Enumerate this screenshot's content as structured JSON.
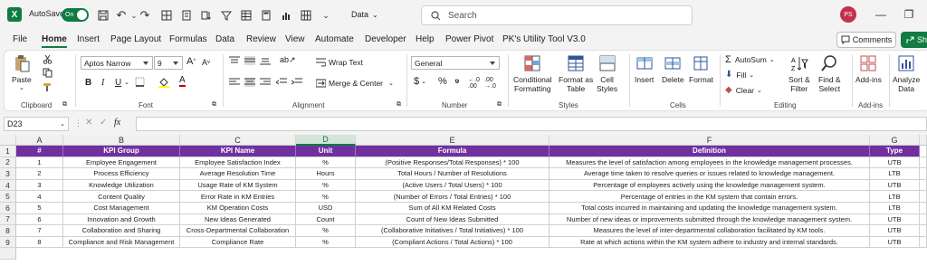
{
  "titlebar": {
    "logo": "X",
    "autosave_label": "AutoSave",
    "autosave_state": "On",
    "doc_name": "Data",
    "search_placeholder": "Search",
    "user_initials": "PS"
  },
  "tabs": [
    "File",
    "Home",
    "Insert",
    "Page Layout",
    "Formulas",
    "Data",
    "Review",
    "View",
    "Automate",
    "Developer",
    "Help",
    "Power Pivot",
    "PK's Utility Tool V3.0"
  ],
  "active_tab": "Home",
  "comments_label": "Comments",
  "share_label": "Sha",
  "ribbon": {
    "clipboard": {
      "paste": "Paste",
      "label": "Clipboard"
    },
    "font": {
      "name": "Aptos Narrow",
      "size": "9",
      "label": "Font"
    },
    "alignment": {
      "wrap": "Wrap Text",
      "merge": "Merge & Center",
      "label": "Alignment"
    },
    "number": {
      "format": "General",
      "label": "Number"
    },
    "styles": {
      "conditional": "Conditional",
      "conditional2": "Formatting",
      "format_as": "Format as",
      "format_as2": "Table",
      "cell": "Cell",
      "cell2": "Styles",
      "label": "Styles"
    },
    "cells": {
      "insert": "Insert",
      "delete": "Delete",
      "format": "Format",
      "label": "Cells"
    },
    "editing": {
      "autosum": "AutoSum",
      "fill": "Fill",
      "clear": "Clear",
      "sort": "Sort &",
      "sort2": "Filter",
      "find": "Find &",
      "find2": "Select",
      "label": "Editing"
    },
    "addins": {
      "addins": "Add-ins",
      "label": "Add-ins"
    },
    "analyze": {
      "line1": "Analyze",
      "line2": "Data"
    }
  },
  "formula_bar": {
    "name_box": "D23",
    "fx": "fx",
    "value": ""
  },
  "grid": {
    "columns": [
      "A",
      "B",
      "C",
      "D",
      "E",
      "F",
      "G"
    ],
    "selected_column": "D",
    "headers": [
      "#",
      "KPI Group",
      "KPI Name",
      "Unit",
      "Formula",
      "Definition",
      "Type"
    ],
    "rows": [
      [
        "1",
        "Employee Engagement",
        "Employee Satisfaction Index",
        "%",
        "(Positive Responses/Total Responses) * 100",
        "Measures the level of satisfaction among employees in the knowledge management processes.",
        "UTB"
      ],
      [
        "2",
        "Process Efficiency",
        "Average Resolution Time",
        "Hours",
        "Total Hours / Number of Resolutions",
        "Average time taken to resolve queries or issues related to knowledge management.",
        "LTB"
      ],
      [
        "3",
        "Knowledge Utilization",
        "Usage Rate of KM System",
        "%",
        "(Active Users / Total Users) * 100",
        "Percentage of employees actively using the knowledge management system.",
        "UTB"
      ],
      [
        "4",
        "Content Quality",
        "Error Rate in KM Entries",
        "%",
        "(Number of Errors / Total Entries) * 100",
        "Percentage of entries in the KM system that contain errors.",
        "LTB"
      ],
      [
        "5",
        "Cost Management",
        "KM Operation Costs",
        "USD",
        "Sum of All KM Related Costs",
        "Total costs incurred in maintaining and updating the knowledge management system.",
        "LTB"
      ],
      [
        "6",
        "Innovation and Growth",
        "New Ideas Generated",
        "Count",
        "Count of New Ideas Submitted",
        "Number of new ideas or improvements submitted through the knowledge management system.",
        "UTB"
      ],
      [
        "7",
        "Collaboration and Sharing",
        "Cross-Departmental Collaboration",
        "%",
        "(Collaborative Initiatives / Total Initiatives) * 100",
        "Measures the level of inter-departmental collaboration facilitated by KM tools.",
        "UTB"
      ],
      [
        "8",
        "Compliance and Risk Management",
        "Compliance Rate",
        "%",
        "(Compliant Actions / Total Actions) * 100",
        "Rate at which actions within the KM system adhere to industry and internal standards.",
        "UTB"
      ]
    ],
    "row_numbers": [
      "1",
      "2",
      "3",
      "4",
      "5",
      "6",
      "7",
      "8",
      "9"
    ]
  },
  "colors": {
    "header_purple": "#7030a0",
    "excel_green": "#107c41"
  }
}
